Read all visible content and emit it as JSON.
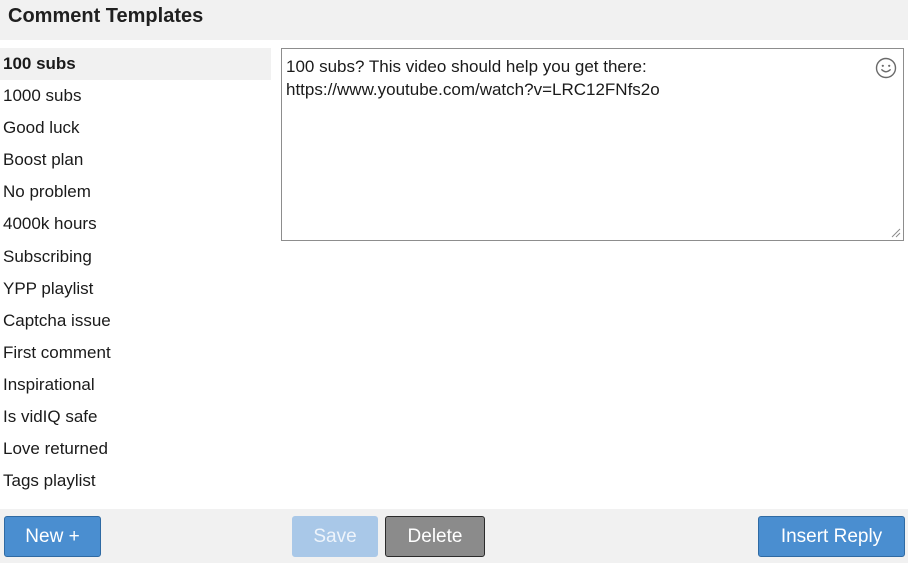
{
  "header": {
    "title": "Comment Templates"
  },
  "templates": {
    "items": [
      "100 subs",
      "1000 subs",
      "Good luck",
      "Boost plan",
      "No problem",
      "4000k hours",
      "Subscribing",
      "YPP playlist",
      "Captcha issue",
      "First comment",
      "Inspirational",
      "Is vidIQ safe",
      "Love returned",
      "Tags playlist"
    ],
    "selected": "100 subs"
  },
  "editor": {
    "text": "100 subs? This video should help you get there:\nhttps://www.youtube.com/watch?v=LRC12FNfs2o",
    "emoji_icon": "smiley-icon"
  },
  "footer": {
    "new_label": "New +",
    "save_label": "Save",
    "delete_label": "Delete",
    "insert_label": "Insert Reply"
  },
  "colors": {
    "primary_button": "#4a8ed0",
    "disabled_button": "#a9c8e8",
    "neutral_button": "#8b8b8b",
    "header_bg": "#f1f1f1"
  }
}
